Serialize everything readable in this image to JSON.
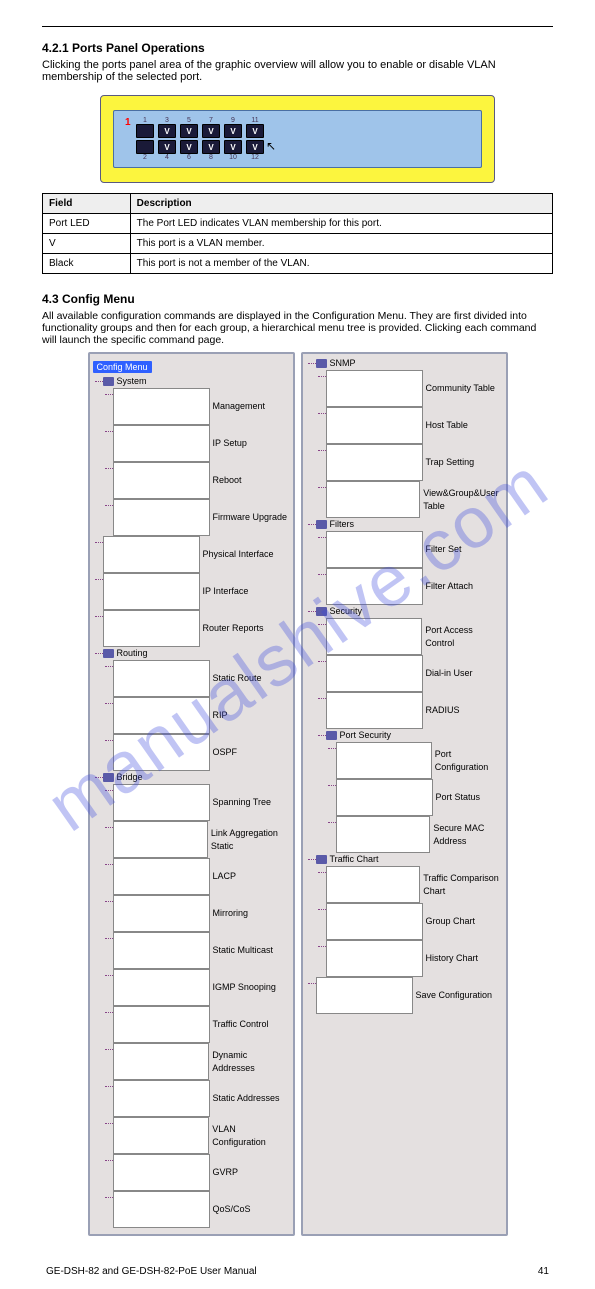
{
  "watermark": "manualshive.com",
  "section1": "4.2.1 Ports Panel Operations",
  "para1": "Clicking the ports panel area of the graphic overview will allow you to enable or disable VLAN membership of the selected port.",
  "device": {
    "marker": "1",
    "rows": [
      {
        "labels": [
          "1",
          "3",
          "5",
          "7",
          "9",
          "11"
        ],
        "ports": [
          "",
          "V",
          "V",
          "V",
          "V",
          "V"
        ]
      },
      {
        "labels": [
          "2",
          "4",
          "6",
          "8",
          "10",
          "12"
        ],
        "ports": [
          "",
          "V",
          "V",
          "V",
          "V",
          "V"
        ]
      }
    ]
  },
  "table": {
    "headers": [
      "Field",
      "Description"
    ],
    "rows": [
      [
        "Port LED",
        "The Port LED indicates VLAN membership for this port."
      ],
      [
        "V",
        "This port is a VLAN member."
      ],
      [
        "Black",
        "This port is not a member of the VLAN."
      ]
    ]
  },
  "cfgHeader": "4.3 Config Menu",
  "cfgPara": "All available configuration commands are displayed in the Configuration Menu. They are first divided into functionality groups and then for each group, a hierarchical menu tree is provided. Clicking each command will launch the specific command page.",
  "treeTitle": "Config Menu",
  "treeLeft": [
    {
      "t": "folder",
      "l": "System",
      "c": [
        {
          "t": "page",
          "l": "Management"
        },
        {
          "t": "page",
          "l": "IP Setup"
        },
        {
          "t": "page",
          "l": "Reboot"
        },
        {
          "t": "page",
          "l": "Firmware Upgrade"
        }
      ]
    },
    {
      "t": "page",
      "l": "Physical Interface"
    },
    {
      "t": "page",
      "l": "IP Interface"
    },
    {
      "t": "page",
      "l": "Router Reports"
    },
    {
      "t": "folder",
      "l": "Routing",
      "c": [
        {
          "t": "page",
          "l": "Static Route"
        },
        {
          "t": "page",
          "l": "RIP"
        },
        {
          "t": "page",
          "l": "OSPF"
        }
      ]
    },
    {
      "t": "folder",
      "l": "Bridge",
      "c": [
        {
          "t": "page",
          "l": "Spanning Tree"
        },
        {
          "t": "page",
          "l": "Link Aggregation Static"
        },
        {
          "t": "page",
          "l": "LACP"
        },
        {
          "t": "page",
          "l": "Mirroring"
        },
        {
          "t": "page",
          "l": "Static Multicast"
        },
        {
          "t": "page",
          "l": "IGMP Snooping"
        },
        {
          "t": "page",
          "l": "Traffic Control"
        },
        {
          "t": "page",
          "l": "Dynamic Addresses"
        },
        {
          "t": "page",
          "l": "Static Addresses"
        },
        {
          "t": "page",
          "l": "VLAN Configuration"
        },
        {
          "t": "page",
          "l": "GVRP"
        },
        {
          "t": "page",
          "l": "QoS/CoS"
        }
      ]
    }
  ],
  "treeRight": [
    {
      "t": "folder",
      "l": "SNMP",
      "c": [
        {
          "t": "page",
          "l": "Community Table"
        },
        {
          "t": "page",
          "l": "Host Table"
        },
        {
          "t": "page",
          "l": "Trap Setting"
        },
        {
          "t": "page",
          "l": "View&Group&User Table"
        }
      ]
    },
    {
      "t": "folder",
      "l": "Filters",
      "c": [
        {
          "t": "page",
          "l": "Filter Set"
        },
        {
          "t": "page",
          "l": "Filter Attach"
        }
      ]
    },
    {
      "t": "folder",
      "l": "Security",
      "c": [
        {
          "t": "page",
          "l": "Port Access Control"
        },
        {
          "t": "page",
          "l": "Dial-in User"
        },
        {
          "t": "page",
          "l": "RADIUS"
        },
        {
          "t": "folder",
          "l": "Port Security",
          "c": [
            {
              "t": "page",
              "l": "Port Configuration"
            },
            {
              "t": "page",
              "l": "Port Status"
            },
            {
              "t": "page",
              "l": "Secure MAC Address"
            }
          ]
        }
      ]
    },
    {
      "t": "folder",
      "l": "Traffic Chart",
      "c": [
        {
          "t": "page",
          "l": "Traffic Comparison Chart"
        },
        {
          "t": "page",
          "l": "Group Chart"
        },
        {
          "t": "page",
          "l": "History Chart"
        }
      ]
    },
    {
      "t": "page",
      "l": "Save Configuration"
    }
  ],
  "footer": {
    "left": "GE-DSH-82 and GE-DSH-82-PoE User Manual",
    "right": "41"
  }
}
